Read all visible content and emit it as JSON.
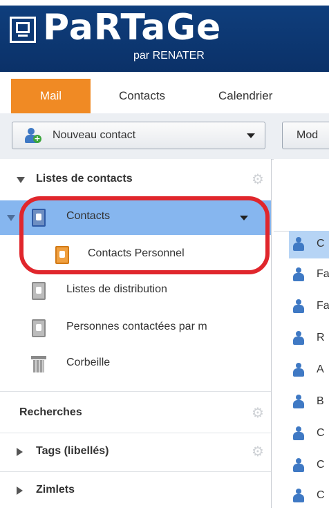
{
  "app": {
    "logo_text": "PaRTaGe",
    "logo_subtitle": "par RENATER"
  },
  "tabs": [
    {
      "label": "Mail",
      "color": "#f08a24"
    },
    {
      "label": "Contacts",
      "active": true
    },
    {
      "label": "Calendrier"
    }
  ],
  "toolbar": {
    "new_contact_label": "Nouveau contact",
    "modify_label": "Mod"
  },
  "sidebar": {
    "contact_lists_header": "Listes de contacts",
    "items": [
      {
        "label": "Contacts",
        "icon": "address-book-icon",
        "selected": true
      },
      {
        "label": "Contacts Personnel",
        "icon": "address-book-icon"
      },
      {
        "label": "Listes de distribution",
        "icon": "address-book-icon"
      },
      {
        "label": "Personnes contactées par m",
        "icon": "address-book-icon"
      },
      {
        "label": "Corbeille",
        "icon": "trash-icon"
      }
    ],
    "searches_header": "Recherches",
    "tags_header": "Tags (libellés)",
    "zimlets_header": "Zimlets"
  },
  "contact_list": {
    "items": [
      "C",
      "Fa",
      "Fa",
      "R",
      "A",
      "B",
      "C",
      "C",
      "C"
    ]
  },
  "colors": {
    "header_bg": "#0b3168",
    "selection": "#86b6ef",
    "annotation": "#e0262c"
  }
}
